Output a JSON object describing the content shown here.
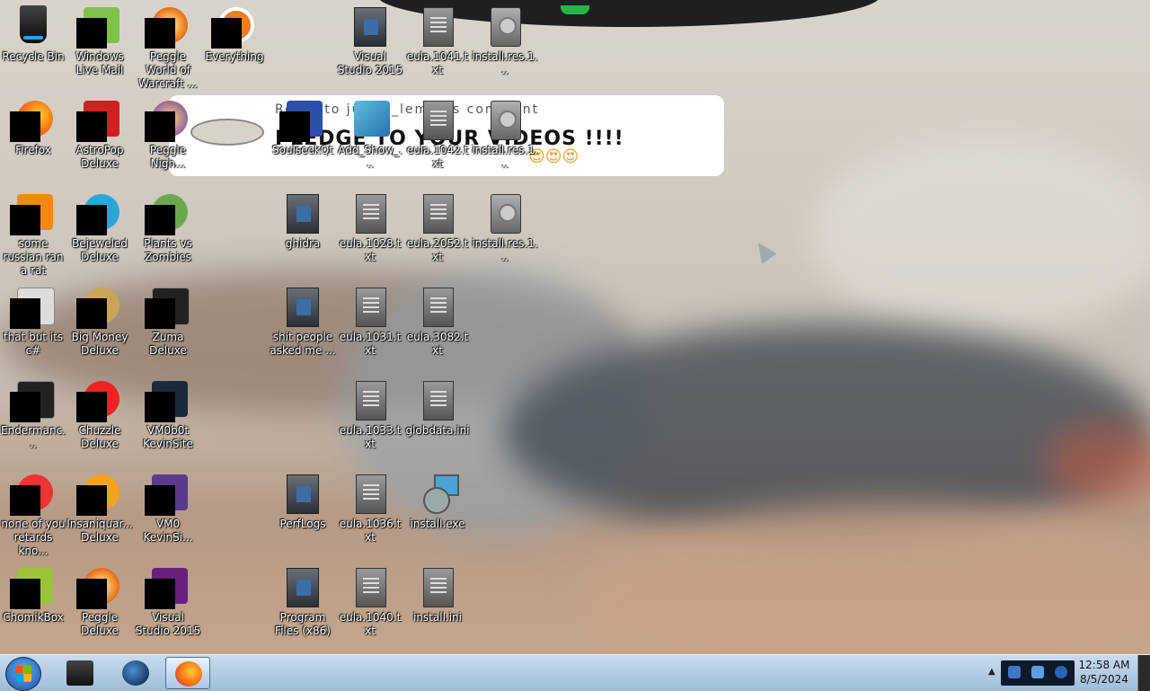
{
  "wallpaper": {
    "comment_reply": "Reply to justin_lemay's comment",
    "comment_text": "PLEDGE TO YOUR VIDEOS !!!!",
    "comment_emoji": "😍😍😍"
  },
  "desktop_icons": [
    {
      "label": "Recycle Bin",
      "icon": "recycle-bin-icon"
    },
    {
      "label": "Windows Live Mail",
      "icon": "mail-icon"
    },
    {
      "label": "Peggle World of Warcraft ...",
      "icon": "peggle-icon"
    },
    {
      "label": "Everything",
      "icon": "search-app-icon"
    },
    {
      "label": "Visual Studio 2015",
      "icon": "folder-icon"
    },
    {
      "label": "eula.1041.txt",
      "icon": "text-file-icon"
    },
    {
      "label": "install.res.1...",
      "icon": "resource-file-icon"
    },
    {
      "label": "Firefox",
      "icon": "firefox-icon"
    },
    {
      "label": "AstroPop Deluxe",
      "icon": "astropop-icon"
    },
    {
      "label": "Peggle Nigh...",
      "icon": "peggle-nights-icon"
    },
    {
      "label": "SoulseekQt",
      "icon": "soulseek-icon"
    },
    {
      "label": "Add_Show_...",
      "icon": "registry-file-icon"
    },
    {
      "label": "eula.1042.txt",
      "icon": "text-file-icon"
    },
    {
      "label": "install.res.1...",
      "icon": "resource-file-icon"
    },
    {
      "label": "some russian ran a rat",
      "icon": "app-icon"
    },
    {
      "label": "Bejeweled Deluxe",
      "icon": "bejeweled-icon"
    },
    {
      "label": "Plants vs Zombies",
      "icon": "pvz-icon"
    },
    {
      "label": "ghidra",
      "icon": "folder-icon"
    },
    {
      "label": "eula.1028.txt",
      "icon": "text-file-icon"
    },
    {
      "label": "eula.2052.txt",
      "icon": "text-file-icon"
    },
    {
      "label": "install.res.1...",
      "icon": "resource-file-icon"
    },
    {
      "label": "that but its c#",
      "icon": "app-icon"
    },
    {
      "label": "Big Money Deluxe",
      "icon": "bigmoney-icon"
    },
    {
      "label": "Zuma Deluxe",
      "icon": "zuma-icon"
    },
    {
      "label": "shit people asked me ...",
      "icon": "folder-icon"
    },
    {
      "label": "eula.1031.txt",
      "icon": "text-file-icon"
    },
    {
      "label": "eula.3082.txt",
      "icon": "text-file-icon"
    },
    {
      "label": "Endermanc...",
      "icon": "app-icon"
    },
    {
      "label": "Chuzzle Deluxe",
      "icon": "chuzzle-icon"
    },
    {
      "label": "VM0b0t KevinSite",
      "icon": "app-icon"
    },
    {
      "label": "eula.1033.txt",
      "icon": "text-file-icon"
    },
    {
      "label": "globdata.ini",
      "icon": "settings-file-icon"
    },
    {
      "label": "none of you retards kno...",
      "icon": "app-icon"
    },
    {
      "label": "Insaniquar... Deluxe",
      "icon": "insaniquarium-icon"
    },
    {
      "label": "VM0 KevinSi...",
      "icon": "app-icon"
    },
    {
      "label": "PerfLogs",
      "icon": "folder-icon"
    },
    {
      "label": "eula.1036.txt",
      "icon": "text-file-icon"
    },
    {
      "label": "install.exe",
      "icon": "installer-icon"
    },
    {
      "label": "ChomikBox",
      "icon": "chomikbox-icon"
    },
    {
      "label": "Peggle Deluxe",
      "icon": "peggle-icon"
    },
    {
      "label": "Visual Studio 2015",
      "icon": "visual-studio-icon"
    },
    {
      "label": "Program Files (x86)",
      "icon": "folder-icon"
    },
    {
      "label": "eula.1040.txt",
      "icon": "text-file-icon"
    },
    {
      "label": "install.ini",
      "icon": "settings-file-icon"
    }
  ],
  "taskbar": {
    "pinned": [
      "file-explorer-icon",
      "globe-icon",
      "firefox-icon"
    ],
    "active_app": "Firefox",
    "clock_time": "12:58 AM",
    "clock_date": "8/5/2024"
  }
}
